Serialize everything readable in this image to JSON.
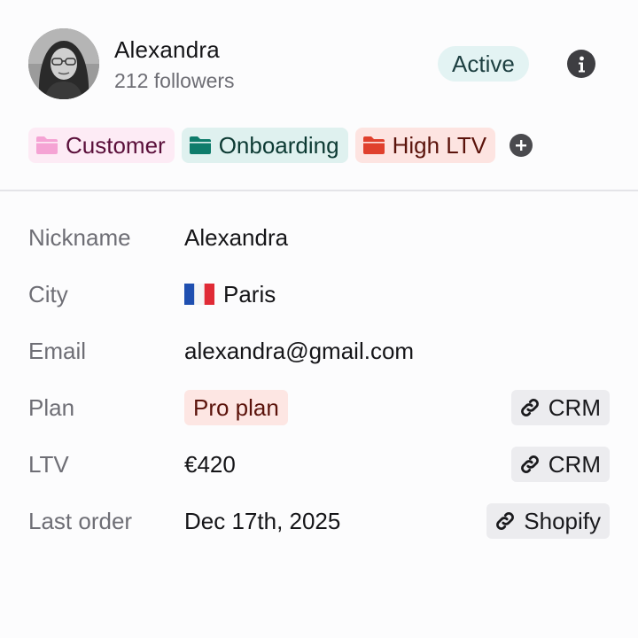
{
  "profile": {
    "name": "Alexandra",
    "followers": "212 followers",
    "status": "Active"
  },
  "tags": [
    {
      "label": "Customer",
      "color": "#f5a3d4"
    },
    {
      "label": "Onboarding",
      "color": "#0e7c6b"
    },
    {
      "label": "High LTV",
      "color": "#e0402d"
    }
  ],
  "fields": [
    {
      "label": "Nickname",
      "value": "Alexandra"
    },
    {
      "label": "City",
      "value": "Paris",
      "flag": "france-flag"
    },
    {
      "label": "Email",
      "value": "alexandra@gmail.com"
    },
    {
      "label": "Plan",
      "value": "Pro plan",
      "source": "CRM"
    },
    {
      "label": "LTV",
      "value": "€420",
      "source": "CRM"
    },
    {
      "label": "Last order",
      "value": "Dec 17th, 2025",
      "source": "Shopify"
    }
  ],
  "colors": {
    "status_bg": "#e3f3f3",
    "plan_badge_bg": "#fde6e3",
    "link_chip_bg": "#ececef"
  }
}
